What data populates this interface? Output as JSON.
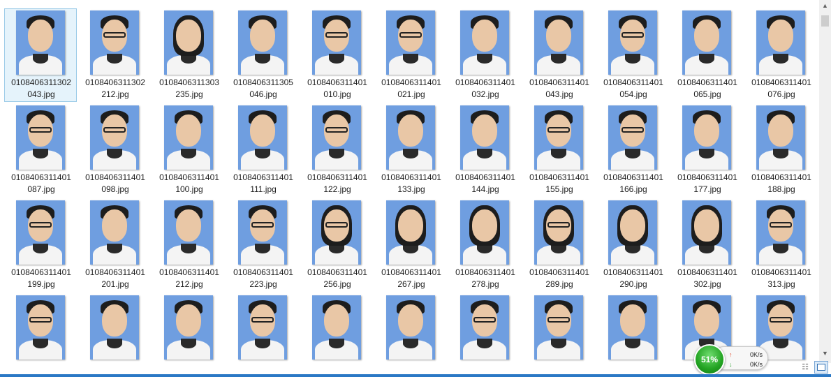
{
  "files": [
    "0108406311302\n043.jpg",
    "0108406311302\n212.jpg",
    "0108406311303\n235.jpg",
    "0108406311305\n046.jpg",
    "0108406311401\n010.jpg",
    "0108406311401\n021.jpg",
    "0108406311401\n032.jpg",
    "0108406311401\n043.jpg",
    "0108406311401\n054.jpg",
    "0108406311401\n065.jpg",
    "0108406311401\n076.jpg",
    "0108406311401\n087.jpg",
    "0108406311401\n098.jpg",
    "0108406311401\n100.jpg",
    "0108406311401\n111.jpg",
    "0108406311401\n122.jpg",
    "0108406311401\n133.jpg",
    "0108406311401\n144.jpg",
    "0108406311401\n155.jpg",
    "0108406311401\n166.jpg",
    "0108406311401\n177.jpg",
    "0108406311401\n188.jpg",
    "0108406311401\n199.jpg",
    "0108406311401\n201.jpg",
    "0108406311401\n212.jpg",
    "0108406311401\n223.jpg",
    "0108406311401\n256.jpg",
    "0108406311401\n267.jpg",
    "0108406311401\n278.jpg",
    "0108406311401\n289.jpg",
    "0108406311401\n290.jpg",
    "0108406311401\n302.jpg",
    "0108406311401\n313.jpg",
    "",
    "",
    "",
    "",
    "",
    "",
    "",
    "",
    "",
    "",
    ""
  ],
  "selected_index": 0,
  "speed_widget": {
    "percent": "51%",
    "upload_speed": "0K/s",
    "download_speed": "0K/s"
  },
  "colors": {
    "accent": "#2b78c5",
    "selection": "#e5f3fb",
    "photo_background": "#6f9ee0"
  },
  "icons": {
    "scroll_up": "scroll-up-arrow-icon",
    "scroll_down": "scroll-down-arrow-icon",
    "details_view": "details-view-icon",
    "thumbnail_view": "thumbnail-view-icon"
  }
}
